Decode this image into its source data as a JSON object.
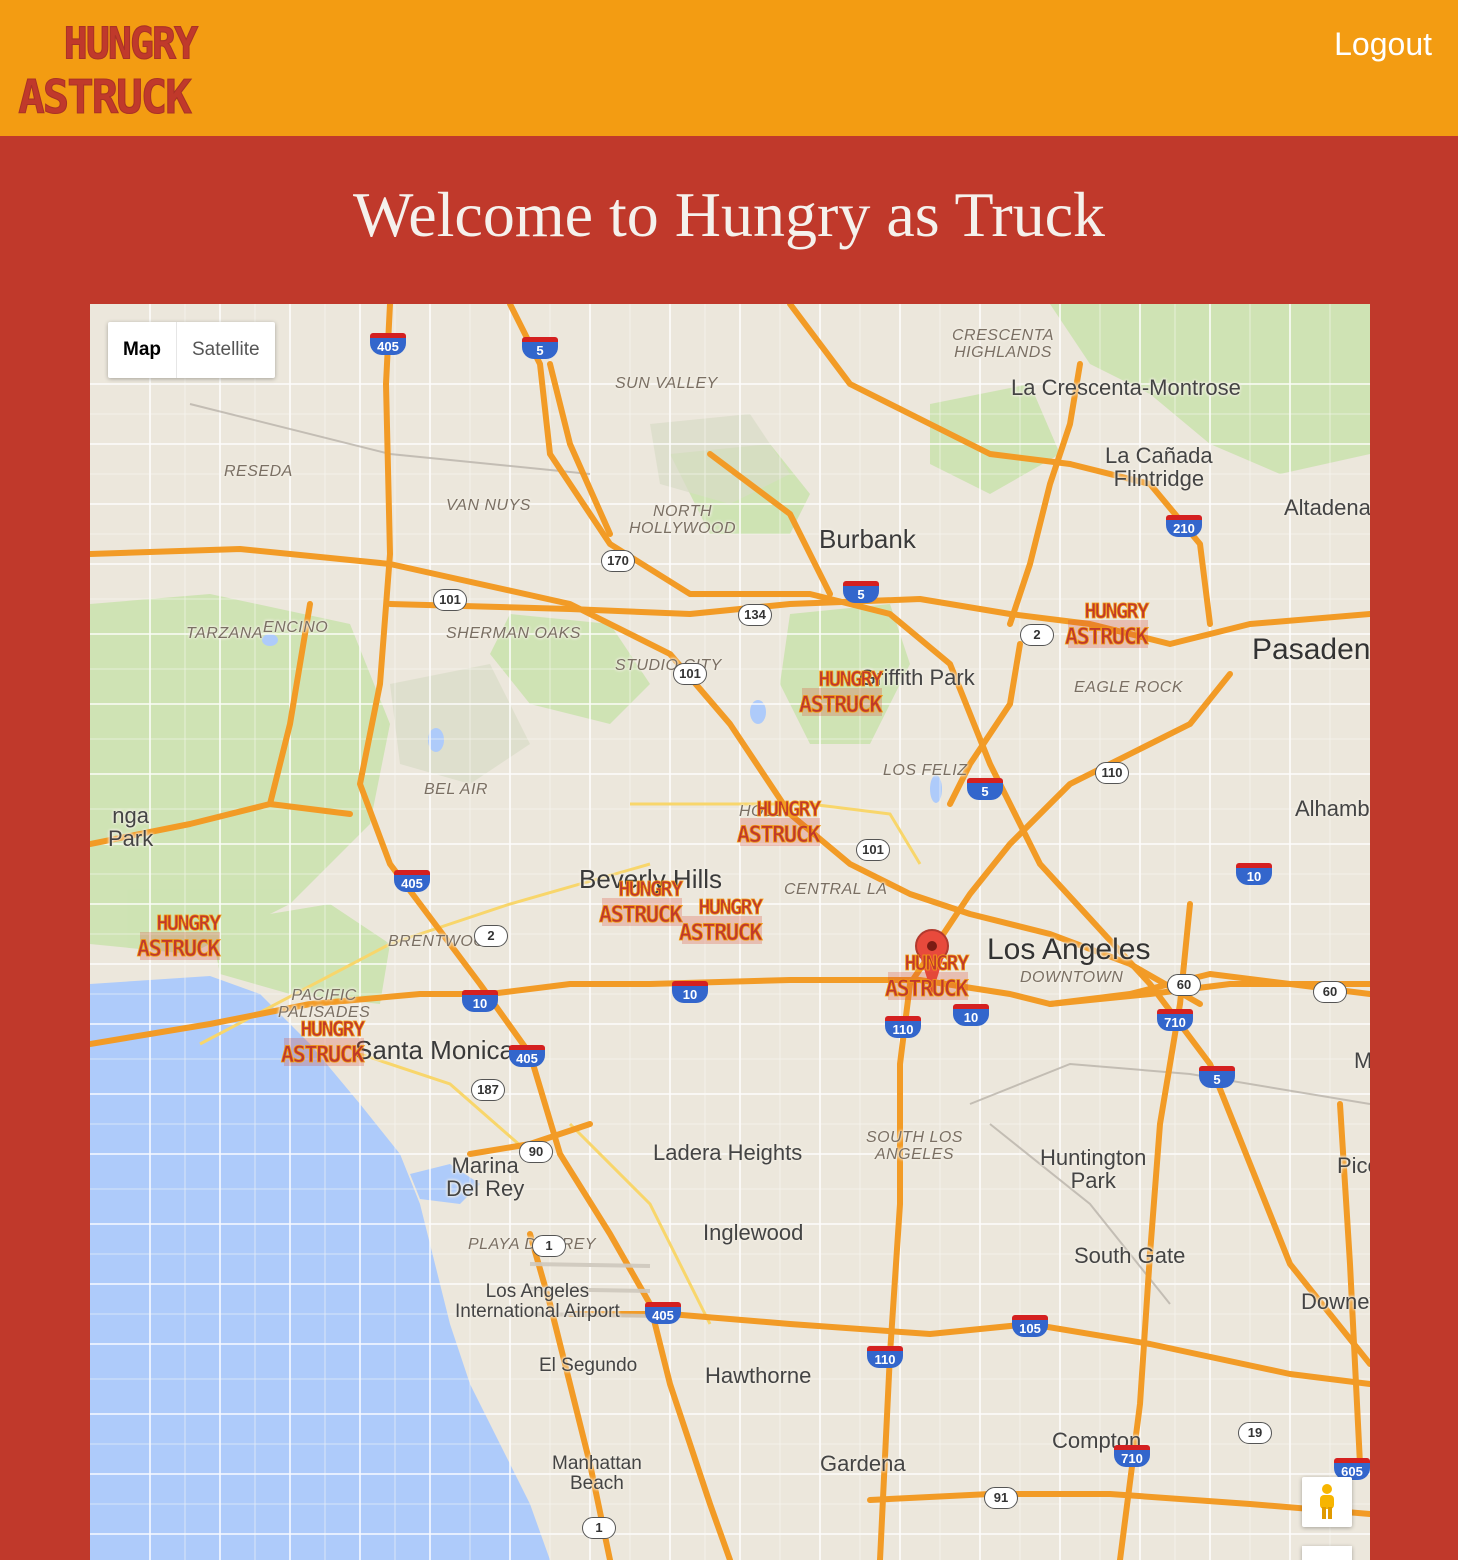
{
  "header": {
    "logo_text": "HUNGRY AS TRUCK",
    "logout_label": "Logout",
    "bg_color": "#f39c12"
  },
  "page": {
    "title": "Welcome to Hungry as Truck",
    "bg_color": "#c0392b"
  },
  "map": {
    "type_control": {
      "map_label": "Map",
      "satellite_label": "Satellite",
      "selected": "Map"
    },
    "labels": [
      {
        "id": "crescenta-highlands",
        "text": "CRESCENTA\nHIGHLANDS",
        "kind": "hood"
      },
      {
        "id": "sun-valley",
        "text": "SUN VALLEY",
        "kind": "hood"
      },
      {
        "id": "la-crescenta",
        "text": "La Crescenta-Montrose",
        "kind": "city"
      },
      {
        "id": "la-canada",
        "text": "La Cañada\nFlintridge",
        "kind": "city"
      },
      {
        "id": "reseda",
        "text": "RESEDA",
        "kind": "hood"
      },
      {
        "id": "van-nuys",
        "text": "VAN NUYS",
        "kind": "hood"
      },
      {
        "id": "north-hollywood",
        "text": "NORTH\nHOLLYWOOD",
        "kind": "hood"
      },
      {
        "id": "burbank",
        "text": "Burbank",
        "kind": "med"
      },
      {
        "id": "altadena",
        "text": "Altadena",
        "kind": "city"
      },
      {
        "id": "tarzana",
        "text": "TARZANA",
        "kind": "hood"
      },
      {
        "id": "encino",
        "text": "ENCINO",
        "kind": "hood"
      },
      {
        "id": "sherman-oaks",
        "text": "SHERMAN OAKS",
        "kind": "hood"
      },
      {
        "id": "studio-city",
        "text": "STUDIO CITY",
        "kind": "hood"
      },
      {
        "id": "griffith-park",
        "text": "Griffith Park",
        "kind": "city"
      },
      {
        "id": "eagle-rock",
        "text": "EAGLE ROCK",
        "kind": "hood"
      },
      {
        "id": "pasadena",
        "text": "Pasadena",
        "kind": "big"
      },
      {
        "id": "topanga",
        "text": "nga\nPark",
        "kind": "city"
      },
      {
        "id": "bel-air",
        "text": "BEL AIR",
        "kind": "hood"
      },
      {
        "id": "los-feliz",
        "text": "LOS FELIZ",
        "kind": "hood"
      },
      {
        "id": "alhambra",
        "text": "Alhambra",
        "kind": "city"
      },
      {
        "id": "hollywood",
        "text": "HOLL",
        "kind": "hood"
      },
      {
        "id": "beverly-hills",
        "text": "Beverly Hills",
        "kind": "med"
      },
      {
        "id": "central-la",
        "text": "CENTRAL LA",
        "kind": "hood"
      },
      {
        "id": "brentwood",
        "text": "BRENTWOOD",
        "kind": "hood"
      },
      {
        "id": "los-angeles",
        "text": "Los Angeles",
        "kind": "big"
      },
      {
        "id": "downtown",
        "text": "DOWNTOWN",
        "kind": "hood"
      },
      {
        "id": "pacific-palisades",
        "text": "PACIFIC\nPALISADES",
        "kind": "hood"
      },
      {
        "id": "santa-monica",
        "text": "Santa Monica",
        "kind": "med"
      },
      {
        "id": "montebello",
        "text": "Montebe",
        "kind": "city"
      },
      {
        "id": "marina-del-rey",
        "text": "Marina\nDel Rey",
        "kind": "city"
      },
      {
        "id": "ladera-heights",
        "text": "Ladera Heights",
        "kind": "city"
      },
      {
        "id": "south-los-angeles",
        "text": "SOUTH LOS\nANGELES",
        "kind": "hood"
      },
      {
        "id": "huntington-park",
        "text": "Huntington\nPark",
        "kind": "city"
      },
      {
        "id": "pico",
        "text": "Pico",
        "kind": "city"
      },
      {
        "id": "inglewood",
        "text": "Inglewood",
        "kind": "city"
      },
      {
        "id": "playa-del-rey",
        "text": "PLAYA DEL REY",
        "kind": "hood"
      },
      {
        "id": "south-gate",
        "text": "South Gate",
        "kind": "city"
      },
      {
        "id": "lax",
        "text": "Los Angeles\nInternational Airport",
        "kind": "small"
      },
      {
        "id": "downey",
        "text": "Downey",
        "kind": "city"
      },
      {
        "id": "el-segundo",
        "text": "El Segundo",
        "kind": "small"
      },
      {
        "id": "hawthorne",
        "text": "Hawthorne",
        "kind": "city"
      },
      {
        "id": "compton",
        "text": "Compton",
        "kind": "city"
      },
      {
        "id": "manhattan-beach",
        "text": "Manhattan\nBeach",
        "kind": "small"
      },
      {
        "id": "gardena",
        "text": "Gardena",
        "kind": "city"
      }
    ],
    "shields": [
      {
        "num": "405",
        "type": "interstate"
      },
      {
        "num": "5",
        "type": "interstate"
      },
      {
        "num": "170",
        "type": "state"
      },
      {
        "num": "101",
        "type": "state"
      },
      {
        "num": "134",
        "type": "state"
      },
      {
        "num": "5",
        "type": "interstate"
      },
      {
        "num": "210",
        "type": "interstate"
      },
      {
        "num": "2",
        "type": "state"
      },
      {
        "num": "101",
        "type": "state"
      },
      {
        "num": "110",
        "type": "state"
      },
      {
        "num": "5",
        "type": "interstate"
      },
      {
        "num": "101",
        "type": "state"
      },
      {
        "num": "405",
        "type": "interstate"
      },
      {
        "num": "10",
        "type": "interstate"
      },
      {
        "num": "2",
        "type": "state"
      },
      {
        "num": "10",
        "type": "interstate"
      },
      {
        "num": "10",
        "type": "interstate"
      },
      {
        "num": "60",
        "type": "state"
      },
      {
        "num": "60",
        "type": "state"
      },
      {
        "num": "110",
        "type": "interstate"
      },
      {
        "num": "10",
        "type": "interstate"
      },
      {
        "num": "710",
        "type": "interstate"
      },
      {
        "num": "405",
        "type": "interstate"
      },
      {
        "num": "5",
        "type": "interstate"
      },
      {
        "num": "187",
        "type": "state"
      },
      {
        "num": "90",
        "type": "state"
      },
      {
        "num": "1",
        "type": "state"
      },
      {
        "num": "405",
        "type": "interstate"
      },
      {
        "num": "105",
        "type": "interstate"
      },
      {
        "num": "110",
        "type": "interstate"
      },
      {
        "num": "19",
        "type": "state"
      },
      {
        "num": "710",
        "type": "interstate"
      },
      {
        "num": "605",
        "type": "interstate"
      },
      {
        "num": "91",
        "type": "state"
      },
      {
        "num": "1",
        "type": "state"
      }
    ],
    "truck_markers": [
      {
        "id": "truck-pasadena"
      },
      {
        "id": "truck-griffith-park"
      },
      {
        "id": "truck-hollywood"
      },
      {
        "id": "truck-central-la-1"
      },
      {
        "id": "truck-central-la-2"
      },
      {
        "id": "truck-downtown"
      },
      {
        "id": "truck-pacific-palisades"
      },
      {
        "id": "truck-santa-monica"
      }
    ],
    "colors": {
      "land": "#ece7dc",
      "water": "#aecbfa",
      "park": "#cde3b1",
      "freeway": "#f29b26",
      "road": "#ffffff",
      "pin": "#e84a3c"
    }
  }
}
